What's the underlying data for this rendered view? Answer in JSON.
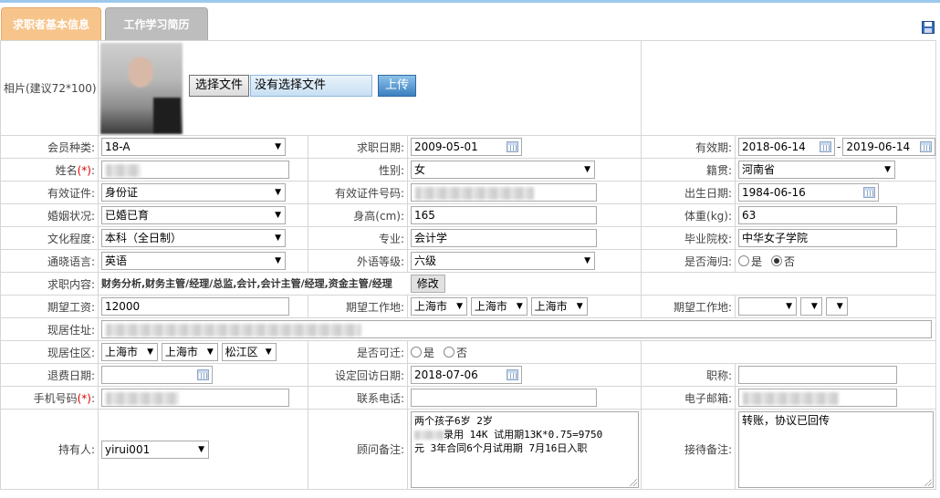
{
  "tabs": [
    {
      "label": "求职者基本信息",
      "active": true
    },
    {
      "label": "工作学习简历",
      "active": false
    }
  ],
  "toolbar": {
    "save_icon": "save-icon"
  },
  "photo": {
    "label": "相片(建议72*100):",
    "choose_file": "选择文件",
    "file_status": "没有选择文件",
    "upload": "上传"
  },
  "fields": {
    "member_type": {
      "label": "会员种类:",
      "value": "18-A"
    },
    "job_date": {
      "label": "求职日期:",
      "value": "2009-05-01"
    },
    "valid_period": {
      "label": "有效期:",
      "from": "2018-06-14",
      "sep": "-",
      "to": "2019-06-14"
    },
    "name": {
      "label": "姓名",
      "req": "(*)",
      "colon": ":"
    },
    "gender": {
      "label": "性别:",
      "value": "女"
    },
    "native_place": {
      "label": "籍贯:",
      "value": "河南省"
    },
    "id_type": {
      "label": "有效证件:",
      "value": "身份证"
    },
    "id_number": {
      "label": "有效证件号码:"
    },
    "birth_date": {
      "label": "出生日期:",
      "value": "1984-06-16"
    },
    "marital": {
      "label": "婚姻状况:",
      "value": "已婚已育"
    },
    "height": {
      "label": "身高(cm):",
      "value": "165"
    },
    "weight": {
      "label": "体重(kg):",
      "value": "63"
    },
    "education": {
      "label": "文化程度:",
      "value": "本科（全日制）"
    },
    "major": {
      "label": "专业:",
      "value": "会计学"
    },
    "school": {
      "label": "毕业院校:",
      "value": "中华女子学院"
    },
    "language": {
      "label": "通晓语言:",
      "value": "英语"
    },
    "foreign_level": {
      "label": "外语等级:",
      "value": "六级"
    },
    "returnee": {
      "label": "是否海归:",
      "yes": "是",
      "no": "否",
      "selected": "否"
    },
    "job_content": {
      "label": "求职内容:",
      "value": "财务分析,财务主管/经理/总监,会计,会计主管/经理,资金主管/经理",
      "modify": "修改"
    },
    "expected_salary": {
      "label": "期望工资:",
      "value": "12000"
    },
    "expected_location": {
      "label": "期望工作地:",
      "v1": "上海市",
      "v2": "上海市",
      "v3": "上海市"
    },
    "expected_location_2": {
      "label": "期望工作地:"
    },
    "address": {
      "label": "现居住址:"
    },
    "district": {
      "label": "现居住区:",
      "v1": "上海市",
      "v2": "上海市",
      "v3": "松江区"
    },
    "relocate": {
      "label": "是否可迁:",
      "yes": "是",
      "no": "否"
    },
    "refund_date": {
      "label": "退费日期:"
    },
    "revisit_date": {
      "label": "设定回访日期:",
      "value": "2018-07-06"
    },
    "title": {
      "label": "职称:"
    },
    "mobile": {
      "label": "手机号码",
      "req": "(*)",
      "colon": ":"
    },
    "phone": {
      "label": "联系电话:"
    },
    "email": {
      "label": "电子邮箱:"
    },
    "holder": {
      "label": "持有人:",
      "value": "yirui001"
    },
    "advisor_note": {
      "label": "顾问备注:",
      "line1": "两个孩子6岁 2岁",
      "line2": "录用 14K 试用期13K*0.75=9750",
      "line3": "元 3年合同6个月试用期 7月16日入职"
    },
    "reception_note": {
      "label": "接待备注:",
      "value": "转账，协议已回传"
    }
  }
}
